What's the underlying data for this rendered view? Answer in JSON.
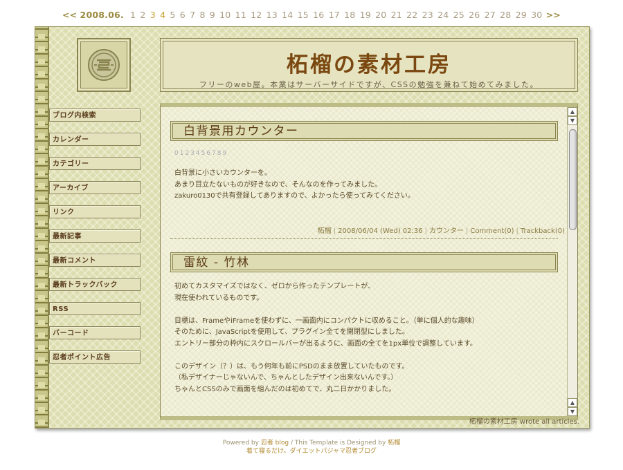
{
  "datenav": {
    "prev": "<<",
    "next": ">>",
    "month": "2008.06.",
    "days": [
      "1",
      "2",
      "3",
      "4",
      "5",
      "6",
      "7",
      "8",
      "9",
      "10",
      "11",
      "12",
      "13",
      "14",
      "15",
      "16",
      "17",
      "18",
      "19",
      "20",
      "21",
      "22",
      "23",
      "24",
      "25",
      "26",
      "27",
      "28",
      "29",
      "30"
    ]
  },
  "header": {
    "title": "柘榴の素材工房",
    "subtitle": "フリーのweb屋。本業はサーバーサイドですが、CSSの勉強を兼ねて始めてみました。"
  },
  "sidebar": {
    "items": [
      {
        "label": "ブログ内検索"
      },
      {
        "label": "カレンダー"
      },
      {
        "label": "カテゴリー"
      },
      {
        "label": "アーカイブ"
      },
      {
        "label": "リンク"
      },
      {
        "label": "最新記事"
      },
      {
        "label": "最新コメント"
      },
      {
        "label": "最新トラックバック"
      },
      {
        "label": "RSS"
      },
      {
        "label": "バーコード"
      },
      {
        "label": "忍者ポイント広告"
      }
    ]
  },
  "entries": [
    {
      "title": "白背景用カウンター",
      "counter": "0123456789",
      "lines": [
        "白背景に小さいカウンターを。",
        "あまり目立たないものが好きなので、そんなのを作ってみました。",
        "zakuro0130で共有登録してありますので、よかったら使ってみてください。"
      ],
      "meta": {
        "author": "柘榴",
        "date": "2008/06/04 (Wed) 02:36",
        "category": "カウンター",
        "comment": "Comment(0)",
        "trackback": "Trackback(0)"
      }
    },
    {
      "title": "雷紋 - 竹林",
      "lines": [
        "初めてカスタマイズではなく、ゼロから作ったテンプレートが、",
        "現在使われているものです。",
        "",
        "目標は、FrameやiFrameを使わずに、一画面内にコンパクトに収めること。（単に個人的な趣味）",
        "そのために、JavaScriptを使用して、プラグイン全てを開閉型にしました。",
        "エントリー部分の枠内にスクロールバーが出るように、画面の全てを1px単位で調整しています。",
        "",
        "このデザイン（？）は、もう何年も前にPSDのまま放置していたものです。",
        "（私デザイナーじゃないんで、ちゃんとしたデザイン出来ないんです。）",
        "ちゃんとCSSのみで画面を組んだのは初めてで、丸二日かかりました。"
      ]
    }
  ],
  "wrote": "柘榴の素材工房 wrote all articles.",
  "footer": {
    "powered_prefix": "Powered by",
    "powered_link": "忍者 blog",
    "designed": "/ This Template is Designed by",
    "designer": "柘榴",
    "line2": "着て寝るだけ。ダイエットパジャマ忍者ブログ"
  },
  "colors": {
    "accent": "#7a4810",
    "frame": "#ddddb2",
    "border": "#8a8450"
  },
  "icons": {
    "logo": "chinese-longevity-medallion-icon",
    "scroll_up": "triangle-up-icon",
    "scroll_down": "triangle-down-icon"
  }
}
